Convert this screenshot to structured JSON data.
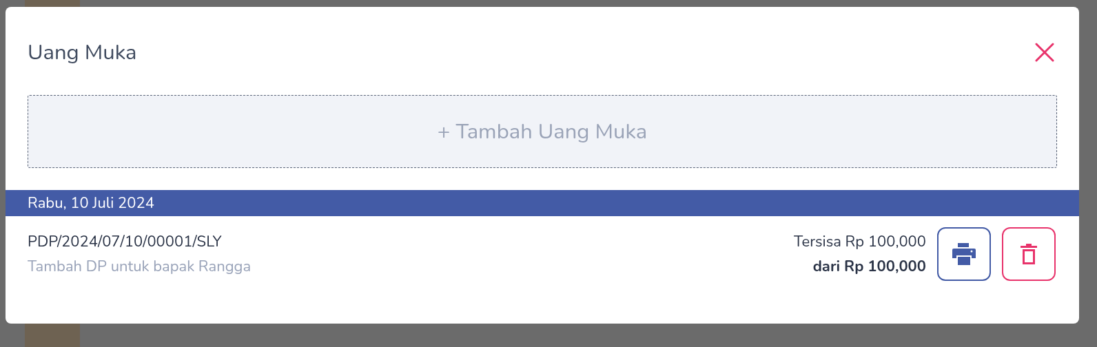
{
  "modal": {
    "title": "Uang Muka",
    "add_button": "+ Tambah Uang Muka",
    "groups": [
      {
        "date": "Rabu, 10 Juli 2024",
        "entries": [
          {
            "number": "PDP/2024/07/10/00001/SLY",
            "note": "Tambah DP untuk bapak Rangga",
            "remaining": "Tersisa Rp 100,000",
            "total": "dari Rp 100,000"
          }
        ]
      }
    ]
  }
}
